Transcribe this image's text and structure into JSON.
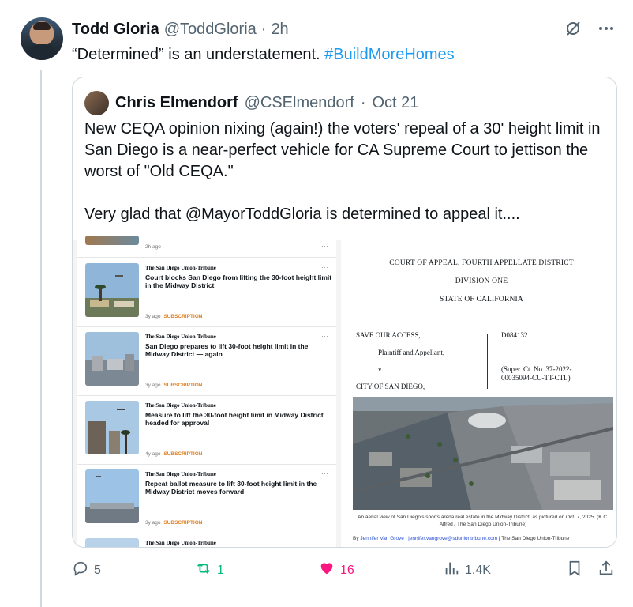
{
  "tweet": {
    "author_name": "Todd Gloria",
    "author_handle": "@ToddGloria",
    "separator": "·",
    "time": "2h",
    "text_main": "“Determined” is an understatement.",
    "hashtag": "#BuildMoreHomes",
    "grok_icon": "slash-circle-icon",
    "more_icon": "more-dots-icon"
  },
  "quote": {
    "author_name": "Chris Elmendorf",
    "author_handle": "@CSElmendorf",
    "separator": "·",
    "time": "Oct 21",
    "text": "New CEQA opinion nixing (again!) the voters' repeal of a 30' height limit in San Diego is a near-perfect vehicle for CA Supreme Court to jettison the worst of \"Old CEQA.\"\n\nVery glad that @MayorToddGloria is determined to appeal it...."
  },
  "news": {
    "top_meta": "2h ago",
    "more": "···",
    "cards": [
      {
        "source": "The San Diego Union-Tribune",
        "headline": "Court blocks San Diego from lifting the 30-foot height limit in the Midway District",
        "age": "3y ago",
        "label": "SUBSCRIPTION"
      },
      {
        "source": "The San Diego Union-Tribune",
        "headline": "San Diego prepares to lift 30-foot height limit in the Midway District — again",
        "age": "3y ago",
        "label": "SUBSCRIPTION"
      },
      {
        "source": "The San Diego Union-Tribune",
        "headline": "Measure to lift the 30-foot height limit in Midway District headed for approval",
        "age": "4y ago",
        "label": "SUBSCRIPTION"
      },
      {
        "source": "The San Diego Union-Tribune",
        "headline": "Repeat ballot measure to lift 30-foot height limit in the Midway District moves forward",
        "age": "3y ago",
        "label": "SUBSCRIPTION"
      },
      {
        "source": "The San Diego Union-Tribune",
        "headline": "",
        "age": "",
        "label": ""
      }
    ]
  },
  "document": {
    "court": "COURT OF APPEAL, FOURTH APPELLATE DISTRICT",
    "division": "DIVISION ONE",
    "state": "STATE OF CALIFORNIA",
    "plaintiff": "SAVE OUR ACCESS,",
    "plaintiff_role": "Plaintiff and Appellant,",
    "versus": "v.",
    "defendant": "CITY OF SAN DIEGO,",
    "case_no": "D084132",
    "super_ct": "(Super. Ct. No. 37-2022-",
    "super_ct2": "00035094-CU-TT-CTL)",
    "caption": "An aerial view of San Diego's sports arena real estate in the Midway District, as pictured on Oct. 7, 2025. (K.C. Alfred / The San Diego Union-Tribune)",
    "by": "By",
    "author_link": "Jennifer Van Grove",
    "sep": "|",
    "email_link": "jennifer.vangrove@sduniontribune.com",
    "publisher": "| The San Diego Union-Tribune"
  },
  "actions": {
    "replies": "5",
    "reposts": "1",
    "likes": "16",
    "views": "1.4K",
    "reply_icon": "reply-icon",
    "repost_icon": "repost-icon",
    "like_icon": "heart-icon",
    "views_icon": "views-icon",
    "bookmark_icon": "bookmark-icon",
    "share_icon": "share-icon",
    "colors": {
      "repost": "#00ba7c",
      "like": "#f91880",
      "link": "#1d9bf0",
      "muted": "#536471"
    }
  }
}
